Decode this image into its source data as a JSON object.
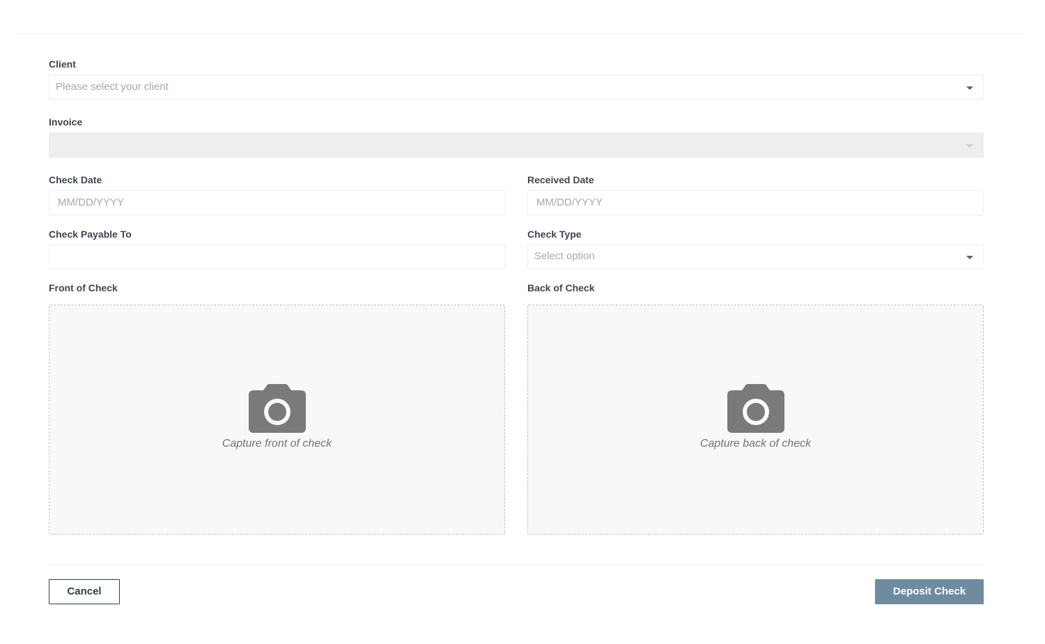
{
  "form": {
    "client": {
      "label": "Client",
      "placeholder": "Please select your client"
    },
    "invoice": {
      "label": "Invoice",
      "value": ""
    },
    "check_date": {
      "label": "Check Date",
      "placeholder": "MM/DD/YYYY"
    },
    "received_date": {
      "label": "Received Date",
      "placeholder": "MM/DD/YYYY"
    },
    "check_payable_to": {
      "label": "Check Payable To",
      "value": ""
    },
    "check_type": {
      "label": "Check Type",
      "placeholder": "Select option"
    },
    "front_of_check": {
      "label": "Front of Check",
      "prompt": "Capture front of check",
      "icon": "camera-icon"
    },
    "back_of_check": {
      "label": "Back of Check",
      "prompt": "Capture back of check",
      "icon": "camera-icon"
    }
  },
  "actions": {
    "cancel_label": "Cancel",
    "deposit_label": "Deposit Check"
  },
  "colors": {
    "deposit_button": "#6e8ba0",
    "cancel_border": "#2f3e4d",
    "camera_icon": "#7a7a7a"
  }
}
